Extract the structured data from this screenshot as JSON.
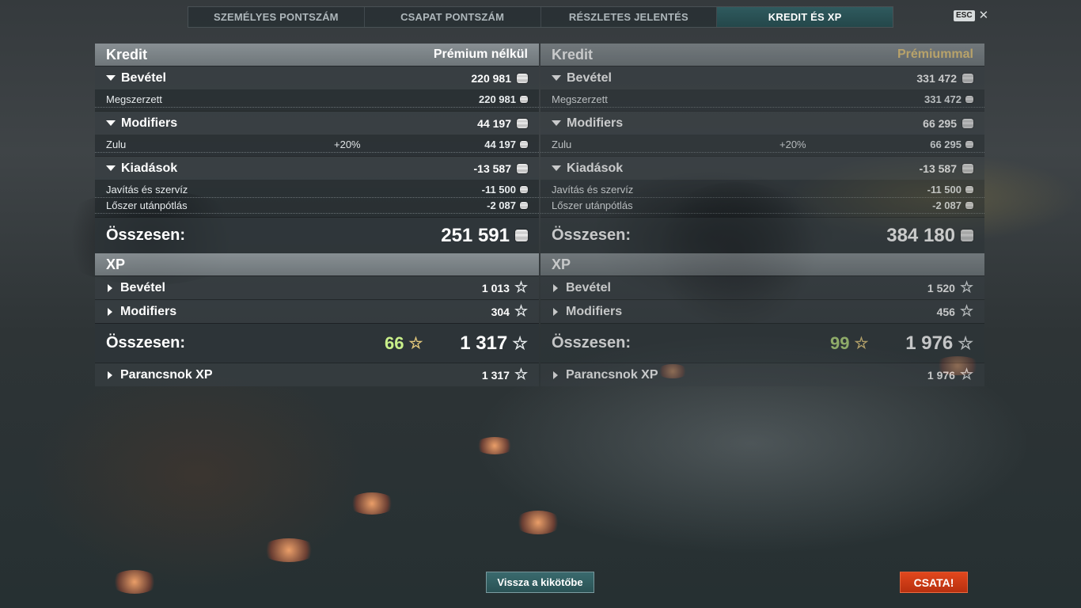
{
  "tabs": [
    {
      "label": "SZEMÉLYES PONTSZÁM",
      "active": false
    },
    {
      "label": "CSAPAT PONTSZÁM",
      "active": false
    },
    {
      "label": "RÉSZLETES JELENTÉS",
      "active": false
    },
    {
      "label": "KREDIT ÉS XP",
      "active": true
    }
  ],
  "esc": {
    "key": "ESC",
    "close": "✕"
  },
  "left": {
    "credit": {
      "title": "Kredit",
      "mode": "Prémium nélkül",
      "income": {
        "label": "Bevétel",
        "value": "220 981",
        "items": [
          {
            "label": "Megszerzett",
            "value": "220 981"
          }
        ]
      },
      "modifiers": {
        "label": "Modifiers",
        "value": "44 197",
        "items": [
          {
            "label": "Zulu",
            "pct": "+20%",
            "value": "44 197"
          }
        ]
      },
      "expenses": {
        "label": "Kiadások",
        "value": "-13 587",
        "items": [
          {
            "label": "Javítás és szervíz",
            "value": "-11 500"
          },
          {
            "label": "Lőszer utánpótlás",
            "value": "-2 087"
          }
        ]
      },
      "total": {
        "label": "Összesen:",
        "value": "251 591"
      }
    },
    "xp": {
      "title": "XP",
      "income": {
        "label": "Bevétel",
        "value": "1 013"
      },
      "modifiers": {
        "label": "Modifiers",
        "value": "304"
      },
      "total": {
        "label": "Összesen:",
        "bonus": "66",
        "value": "1 317"
      },
      "commander": {
        "label": "Parancsnok XP",
        "value": "1 317"
      }
    }
  },
  "right": {
    "credit": {
      "title": "Kredit",
      "mode": "Prémiummal",
      "income": {
        "label": "Bevétel",
        "value": "331 472",
        "items": [
          {
            "label": "Megszerzett",
            "value": "331 472"
          }
        ]
      },
      "modifiers": {
        "label": "Modifiers",
        "value": "66 295",
        "items": [
          {
            "label": "Zulu",
            "pct": "+20%",
            "value": "66 295"
          }
        ]
      },
      "expenses": {
        "label": "Kiadások",
        "value": "-13 587",
        "items": [
          {
            "label": "Javítás és szervíz",
            "value": "-11 500"
          },
          {
            "label": "Lőszer utánpótlás",
            "value": "-2 087"
          }
        ]
      },
      "total": {
        "label": "Összesen:",
        "value": "384 180"
      }
    },
    "xp": {
      "title": "XP",
      "income": {
        "label": "Bevétel",
        "value": "1 520"
      },
      "modifiers": {
        "label": "Modifiers",
        "value": "456"
      },
      "total": {
        "label": "Összesen:",
        "bonus": "99",
        "value": "1 976"
      },
      "commander": {
        "label": "Parancsnok XP",
        "value": "1 976"
      }
    }
  },
  "buttons": {
    "back": "Vissza a kikötőbe",
    "battle": "CSATA!"
  },
  "colors": {
    "active_tab": "#2f5a5e",
    "premium": "#e9c97a",
    "bonus_xp": "#c9f08a",
    "battle": "#d13c16"
  },
  "icons": {
    "credit": "credit-coin-icon",
    "xp": "xp-star-icon"
  }
}
